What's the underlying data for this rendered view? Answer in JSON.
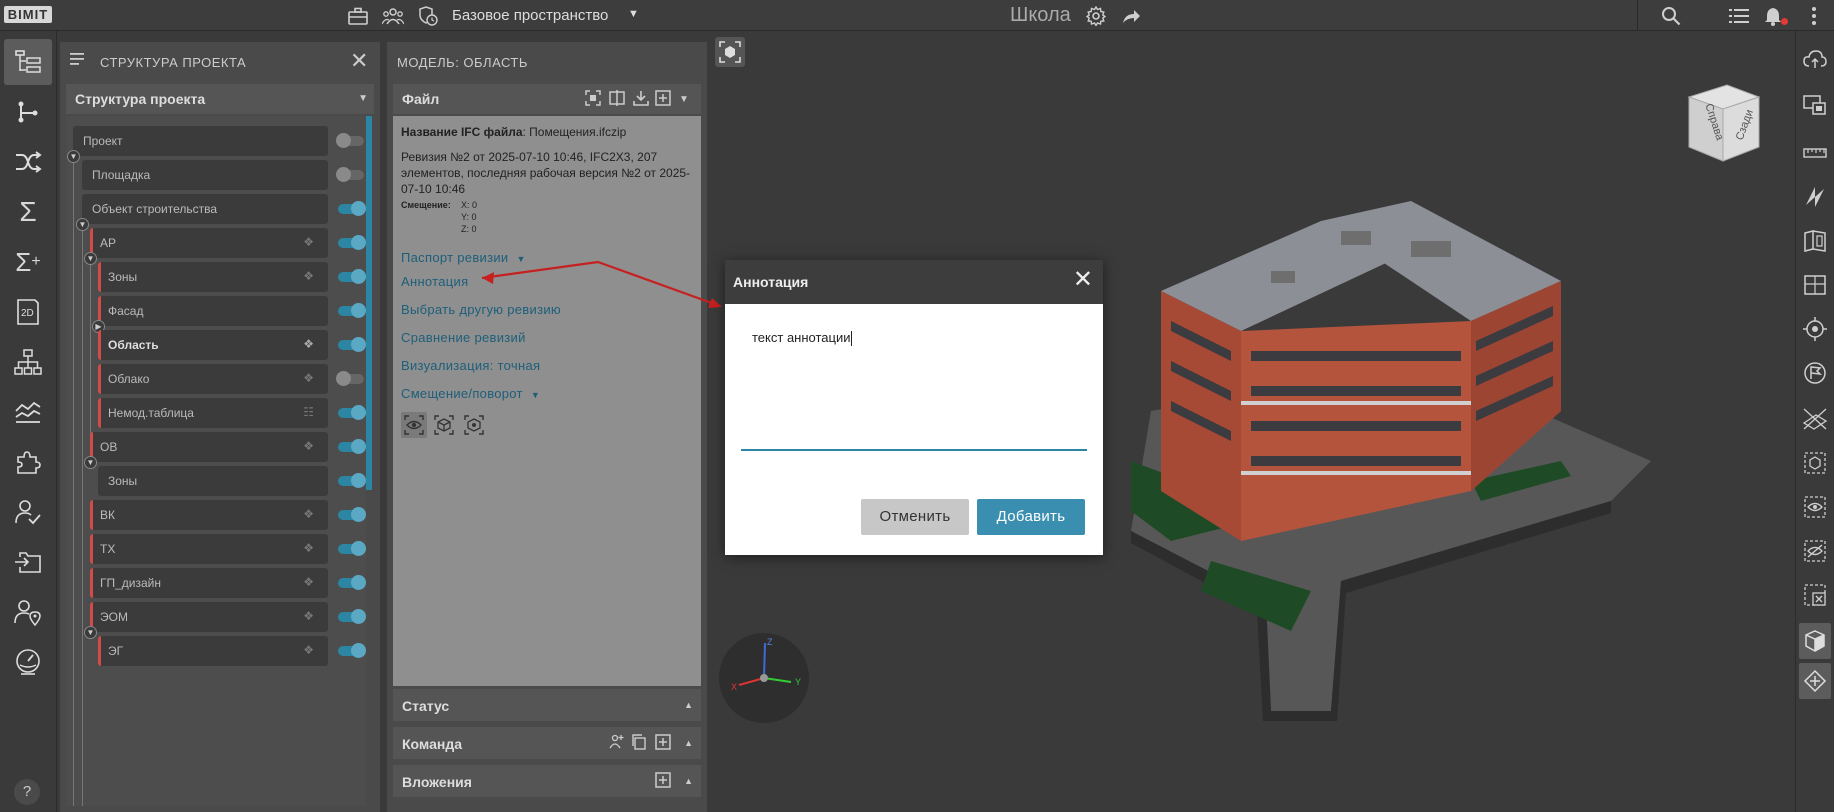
{
  "app": {
    "logo": "BIMIT",
    "space": "Базовое пространство",
    "project_title": "Школа"
  },
  "left_toolbar": {
    "icons": [
      "project-structure-icon",
      "branch-icon",
      "shuffle-icon",
      "sigma-icon",
      "sigma-plus-icon",
      "2d-icon",
      "hierarchy-icon",
      "chart-lines-icon",
      "puzzle-icon",
      "user-check-icon",
      "folder-import-icon",
      "user-location-icon",
      "gauge-icon"
    ],
    "help": "?"
  },
  "structure_panel": {
    "title": "СТРУКТУРА ПРОЕКТА",
    "section": "Структура проекта",
    "nodes": [
      {
        "label": "Проект",
        "on": false
      },
      {
        "label": "Площадка",
        "on": false
      },
      {
        "label": "Объект строительства",
        "on": true
      },
      {
        "label": "АР",
        "on": true
      },
      {
        "label": "Зоны",
        "on": true
      },
      {
        "label": "Фасад",
        "on": true
      },
      {
        "label": "Область",
        "on": true
      },
      {
        "label": "Облако",
        "on": false
      },
      {
        "label": "Немод.таблица",
        "on": true
      },
      {
        "label": "ОВ",
        "on": true
      },
      {
        "label": "Зоны",
        "on": true
      },
      {
        "label": "ВК",
        "on": true
      },
      {
        "label": "ТХ",
        "on": true
      },
      {
        "label": "ГП_дизайн",
        "on": true
      },
      {
        "label": "ЭОМ",
        "on": true
      },
      {
        "label": "ЭГ",
        "on": true
      }
    ]
  },
  "model_panel": {
    "title": "МОДЕЛЬ: ОБЛАСТЬ",
    "file_section": "Файл",
    "ifc_name_label": "Название IFC файла",
    "ifc_name_value": ": Помещения.ifczip",
    "revision_text": "Ревизия №2 от 2025-07-10 10:46, IFC2X3, 207 элементов, последняя рабочая версия №2 от 2025-07-10 10:46",
    "shift_label": "Смещение:",
    "shift_x": "X: 0",
    "shift_y": "Y: 0",
    "shift_z": "Z: 0",
    "links": {
      "passport": "Паспорт ревизии",
      "annotation": "Аннотация",
      "choose_revision": "Выбрать другую ревизию",
      "compare": "Сравнение ревизий",
      "visualization": "Визуализация: точная",
      "offset_rotation": "Смещение/поворот"
    },
    "status_section": "Статус",
    "team_section": "Команда",
    "attachments_section": "Вложения"
  },
  "viewcube": {
    "left": "Справа",
    "right": "Сзади"
  },
  "axes": {
    "x": "X",
    "y": "Y",
    "z": "Z"
  },
  "dialog": {
    "title": "Аннотация",
    "text": "текст аннотации",
    "cancel": "Отменить",
    "add": "Добавить"
  },
  "right_toolbar": {
    "icons": [
      "cloud-upload-icon",
      "screen-select-icon",
      "ruler-icon",
      "section-icon",
      "book-icon",
      "grid-icon",
      "target-icon",
      "flag-icon",
      "cross-plane-icon",
      "box-select-icon",
      "eye-select-icon",
      "eye-hide-icon",
      "box-close-icon",
      "cube-icon",
      "move-icon"
    ]
  }
}
